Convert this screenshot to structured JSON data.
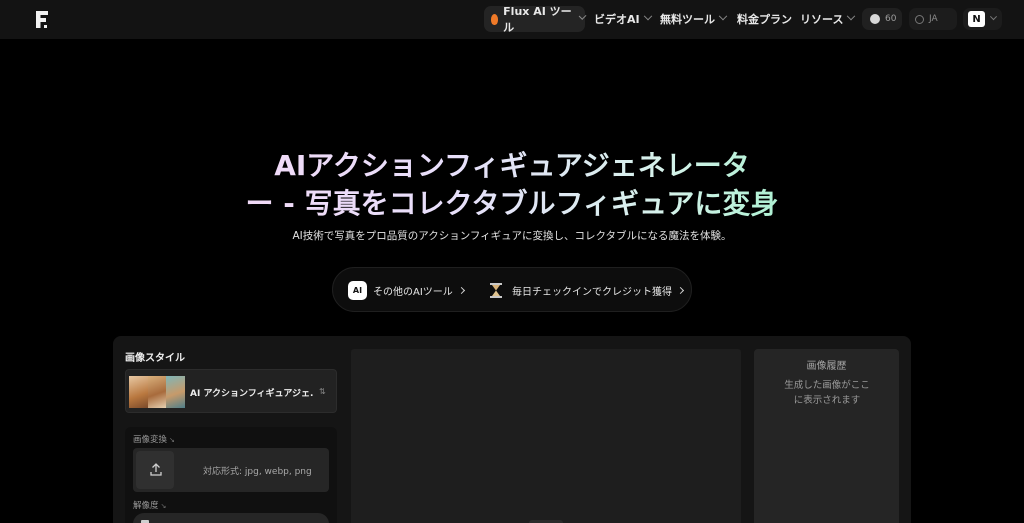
{
  "header": {
    "logo_letter": "F",
    "nav": [
      {
        "label": "Flux AI ツール"
      },
      {
        "label": "ビデオAI"
      },
      {
        "label": "無料ツール"
      },
      {
        "label": "料金プラン"
      },
      {
        "label": "リソース"
      }
    ],
    "credits": "60",
    "language": "JA",
    "user_initial": "N"
  },
  "hero": {
    "title_line1": "AIアクションフィギュアジェネレータ",
    "title_line2": "ー - 写真をコレクタブルフィギュアに変身",
    "subtitle": "AI技術で写真をプロ品質のアクションフィギュアに変換し、コレクタブルになる魔法を体験。"
  },
  "quick_links": {
    "other_tools_badge": "AI",
    "other_tools": "その他のAIツール",
    "daily_checkin": "毎日チェックインでクレジット獲得"
  },
  "left_panel": {
    "title": "画像スタイル",
    "selected_style": "AI アクションフィギュアジェ...",
    "image_convert_label": "画像変換",
    "upload_text": "対応形式: jpg, webp, png",
    "resolution_label": "解像度"
  },
  "history": {
    "title": "画像履歴",
    "empty_text": "生成した画像がここに表示されます"
  },
  "colors": {
    "background": "#000000",
    "header": "#131313",
    "accent_fire": "#f07a28",
    "title_gradient_start": "#f3d9f6",
    "title_gradient_end": "#9ef0c9"
  }
}
